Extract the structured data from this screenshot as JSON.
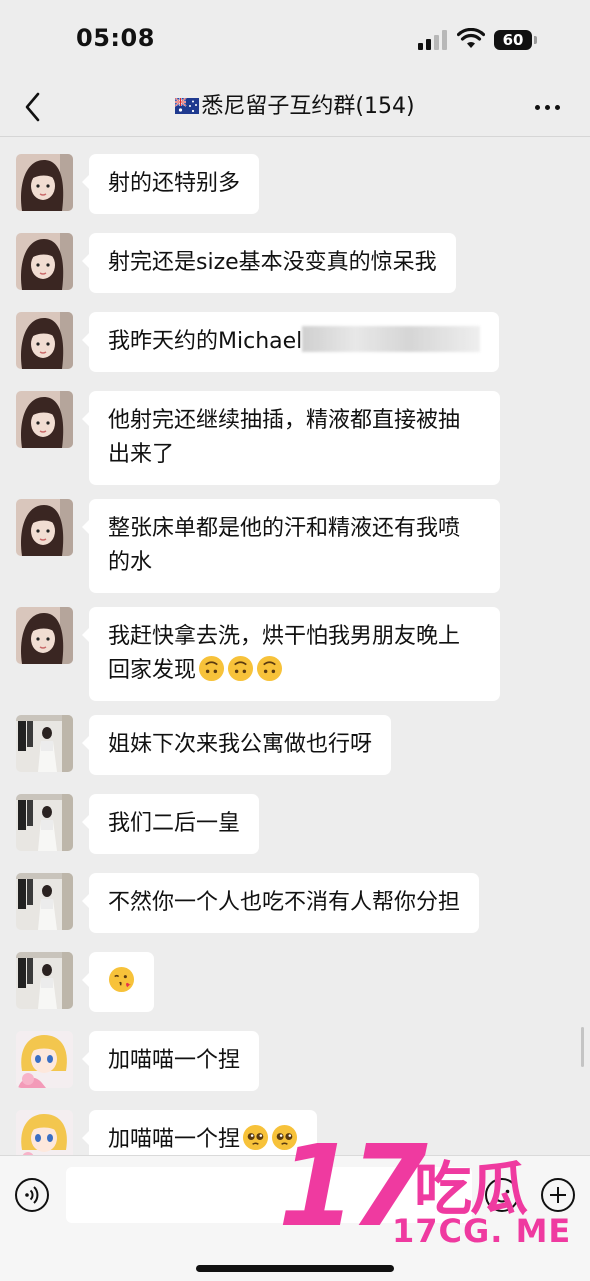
{
  "status_bar": {
    "time": "05:08",
    "battery": "60"
  },
  "header": {
    "flag_icon": "australia-flag",
    "title": "悉尼留子互约群(154)"
  },
  "messages": [
    {
      "sender": "avatar-girl",
      "text": "射的还特别多"
    },
    {
      "sender": "avatar-girl",
      "text": "射完还是size基本没变真的惊呆我"
    },
    {
      "sender": "avatar-girl",
      "text": "我昨天约的Michael"
    },
    {
      "sender": "avatar-girl",
      "text": "他射完还继续抽插，精液都直接被抽出来了"
    },
    {
      "sender": "avatar-girl",
      "text": "整张床单都是他的汗和精液还有我喷的水"
    },
    {
      "sender": "avatar-girl",
      "text": "我赶快拿去洗，烘干怕我男朋友晚上回家发现"
    },
    {
      "sender": "avatar-closet",
      "text": "姐妹下次来我公寓做也行呀"
    },
    {
      "sender": "avatar-closet",
      "text": "我们二后一皇"
    },
    {
      "sender": "avatar-closet",
      "text": "不然你一个人也吃不消有人帮你分担"
    },
    {
      "sender": "avatar-closet",
      "text": ""
    },
    {
      "sender": "avatar-anime",
      "text": "加喵喵一个捏"
    },
    {
      "sender": "avatar-anime",
      "text": "加喵喵一个捏"
    }
  ],
  "watermark": {
    "number": "17",
    "chinese": "吃瓜",
    "url": "17CG. ME"
  },
  "colors": {
    "background": "#ededed",
    "bubble": "#ffffff",
    "watermark": "#ef3aa0"
  }
}
